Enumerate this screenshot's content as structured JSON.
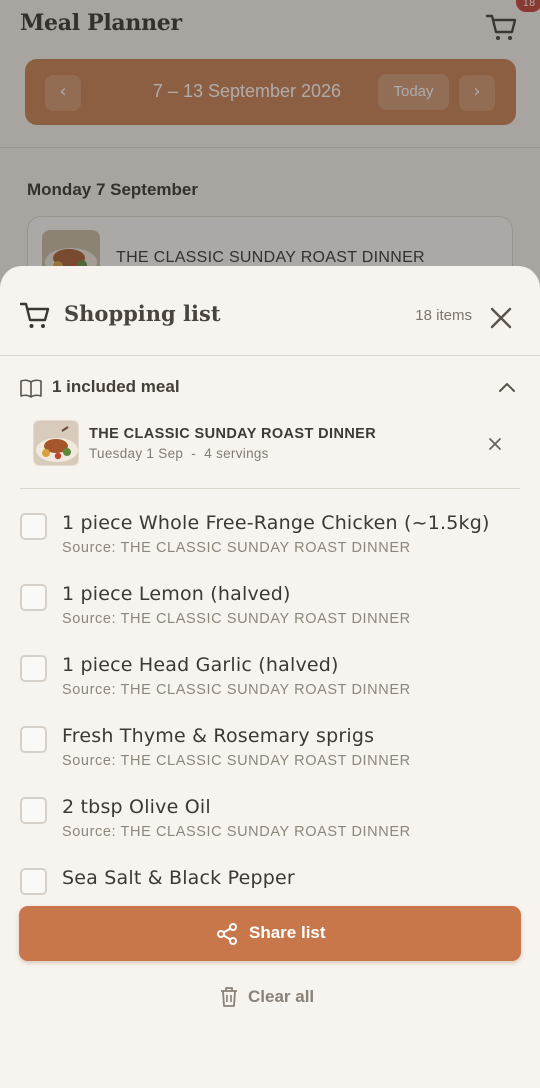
{
  "app": {
    "title": "Meal Planner",
    "cart_badge": "18"
  },
  "week": {
    "label": "7 – 13 September 2026",
    "today_label": "Today",
    "prev_glyph": "‹",
    "next_glyph": "›"
  },
  "day": {
    "heading": "Monday 7 September",
    "meal_name": "THE CLASSIC SUNDAY ROAST DINNER"
  },
  "sheet": {
    "title": "Shopping list",
    "item_count": "18 items",
    "included_label": "1 included meal",
    "meal": {
      "name": "THE CLASSIC SUNDAY ROAST DINNER",
      "meta": "Tuesday 1 Sep  -  4 servings"
    },
    "ingredients": [
      {
        "name": "1 piece Whole Free-Range Chicken (~1.5kg)",
        "source": "Source: THE CLASSIC SUNDAY ROAST DINNER",
        "checked": false
      },
      {
        "name": "1 piece Lemon (halved)",
        "source": "Source: THE CLASSIC SUNDAY ROAST DINNER",
        "checked": false
      },
      {
        "name": "1 piece Head Garlic (halved)",
        "source": "Source: THE CLASSIC SUNDAY ROAST DINNER",
        "checked": false
      },
      {
        "name": "Fresh Thyme & Rosemary sprigs",
        "source": "Source: THE CLASSIC SUNDAY ROAST DINNER",
        "checked": false
      },
      {
        "name": "2 tbsp Olive Oil",
        "source": "Source: THE CLASSIC SUNDAY ROAST DINNER",
        "checked": false
      },
      {
        "name": "Sea Salt & Black Pepper",
        "source": "",
        "checked": false
      }
    ],
    "share_label": "Share list",
    "clear_label": "Clear all"
  },
  "colors": {
    "accent": "#c8774b",
    "background": "#f7f3ee",
    "badge": "#c0392b"
  }
}
